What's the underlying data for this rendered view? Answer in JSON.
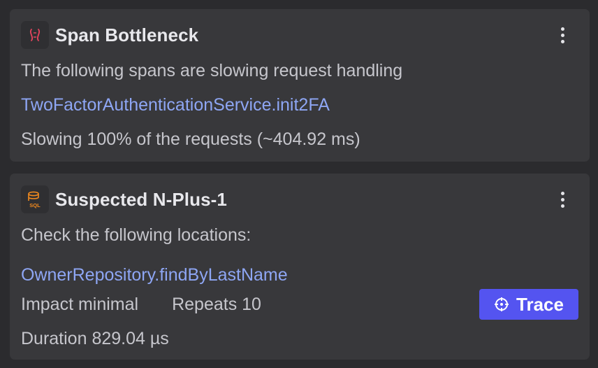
{
  "insights": [
    {
      "title": "Span Bottleneck",
      "icon": "span-bottleneck-icon",
      "icon_color": "#e8445e",
      "description": "The following spans are slowing request handling",
      "span_link": "TwoFactorAuthenticationService.init2FA",
      "detail": "Slowing 100% of the requests (~404.92 ms)"
    },
    {
      "title": "Suspected N-Plus-1",
      "icon": "sql-database-icon",
      "icon_color": "#f28a1e",
      "icon_text": "SQL",
      "description": "Check the following locations:",
      "location_link": "OwnerRepository.findByLastName",
      "impact": "Impact minimal",
      "repeats": "Repeats 10",
      "duration": "Duration 829.04 µs",
      "trace_button": {
        "label": "Trace",
        "icon": "crosshair-icon",
        "color": "#5454f0"
      }
    }
  ],
  "colors": {
    "background": "#2b2b2e",
    "card": "#38383b",
    "link": "#8ea6f4",
    "text": "#c6c6cc",
    "title": "#e8e8ec"
  }
}
